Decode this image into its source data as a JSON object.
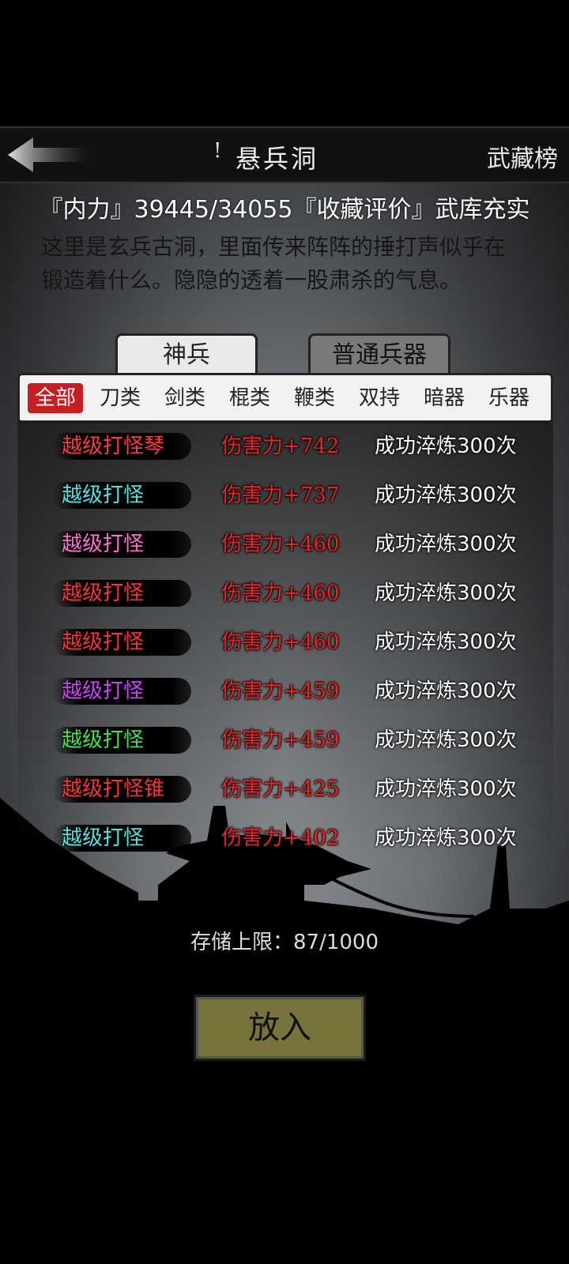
{
  "header": {
    "title_bullet": "!",
    "title": "悬兵洞",
    "rank_link": "武藏榜"
  },
  "stats": {
    "text": "『内力』39445/34055『收藏评价』武库充实"
  },
  "description": "这里是玄兵古洞，里面传来阵阵的捶打声似乎在锻造着什么。隐隐的透着一股肃杀的气息。",
  "tabs": [
    {
      "label": "神兵",
      "active": true
    },
    {
      "label": "普通兵器",
      "active": false
    }
  ],
  "filters": [
    {
      "label": "全部",
      "active": true
    },
    {
      "label": "刀类"
    },
    {
      "label": "剑类"
    },
    {
      "label": "棍类"
    },
    {
      "label": "鞭类"
    },
    {
      "label": "双持"
    },
    {
      "label": "暗器"
    },
    {
      "label": "乐器"
    }
  ],
  "weapons": [
    {
      "name": "越级打怪琴",
      "color": "#ff3b3b",
      "damage": "伤害力+742",
      "refine": "成功淬炼300次"
    },
    {
      "name": "越级打怪",
      "color": "#4fe3e3",
      "damage": "伤害力+737",
      "refine": "成功淬炼300次"
    },
    {
      "name": "越级打怪",
      "color": "#ff6fd2",
      "damage": "伤害力+460",
      "refine": "成功淬炼300次"
    },
    {
      "name": "越级打怪",
      "color": "#ff3030",
      "damage": "伤害力+460",
      "refine": "成功淬炼300次"
    },
    {
      "name": "越级打怪",
      "color": "#ff3030",
      "damage": "伤害力+460",
      "refine": "成功淬炼300次"
    },
    {
      "name": "越级打怪",
      "color": "#d040ff",
      "damage": "伤害力+459",
      "refine": "成功淬炼300次"
    },
    {
      "name": "越级打怪",
      "color": "#44e34a",
      "damage": "伤害力+459",
      "refine": "成功淬炼300次"
    },
    {
      "name": "越级打怪锥",
      "color": "#ff3030",
      "damage": "伤害力+425",
      "refine": "成功淬炼300次"
    },
    {
      "name": "越级打怪",
      "color": "#4fe3e3",
      "damage": "伤害力+402",
      "refine": "成功淬炼300次"
    }
  ],
  "storage": "存储上限：87/1000",
  "put_button": "放入"
}
